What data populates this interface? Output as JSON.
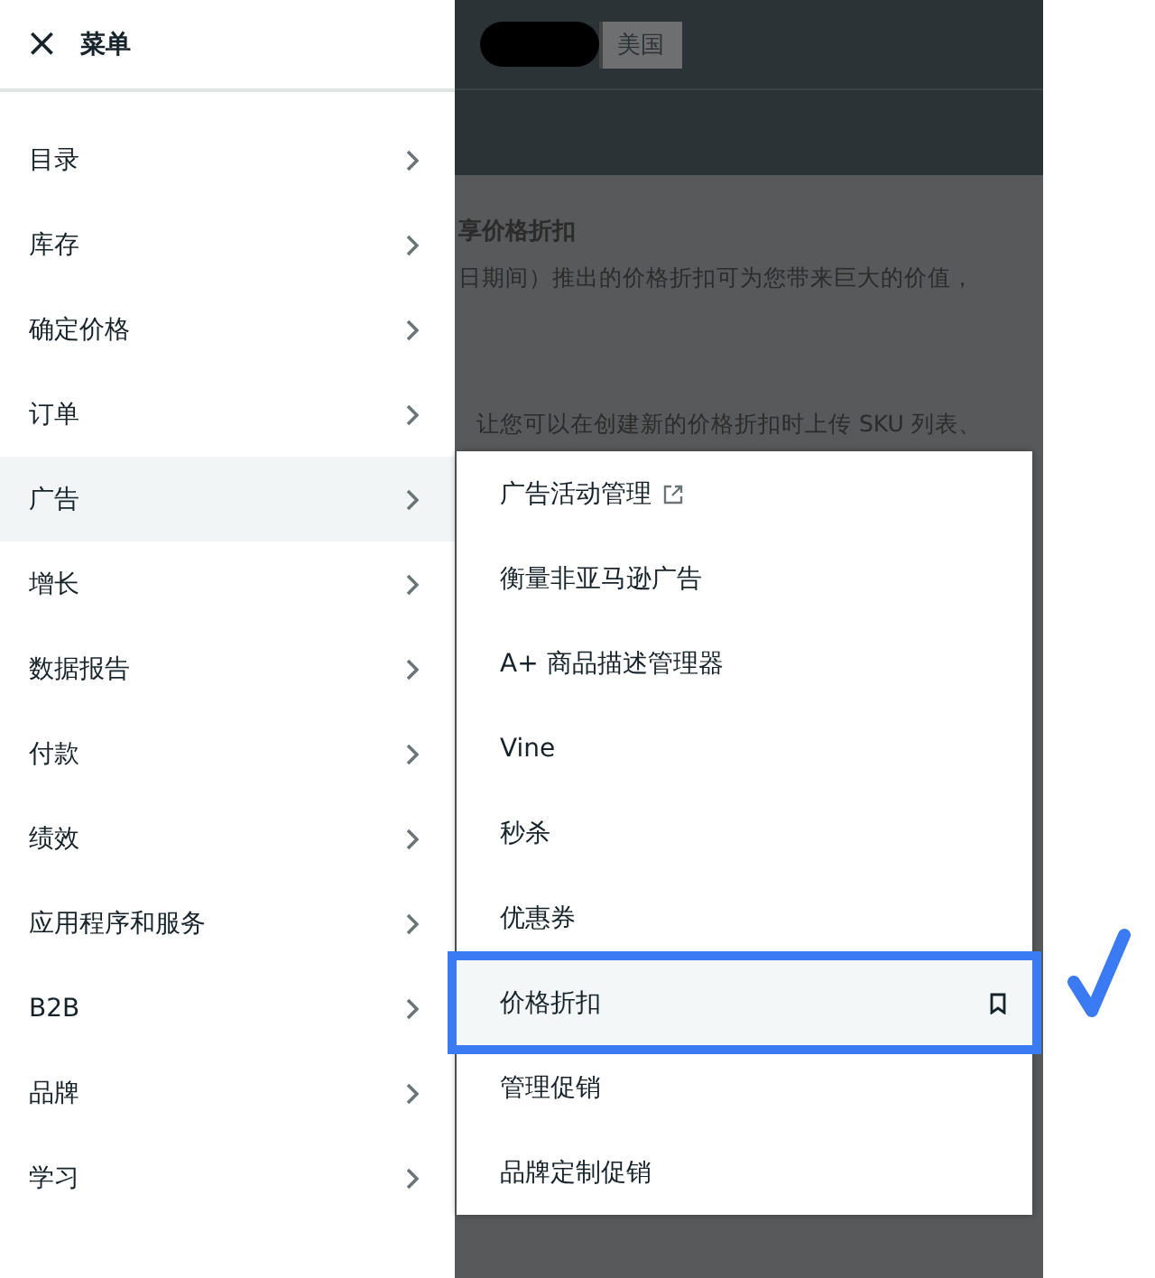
{
  "menu": {
    "close": "×",
    "title": "菜单",
    "items": [
      {
        "label": "目录",
        "selected": false
      },
      {
        "label": "库存",
        "selected": false
      },
      {
        "label": "确定价格",
        "selected": false
      },
      {
        "label": "订单",
        "selected": false
      },
      {
        "label": "广告",
        "selected": true
      },
      {
        "label": "增长",
        "selected": false
      },
      {
        "label": "数据报告",
        "selected": false
      },
      {
        "label": "付款",
        "selected": false
      },
      {
        "label": "绩效",
        "selected": false
      },
      {
        "label": "应用程序和服务",
        "selected": false
      },
      {
        "label": "B2B",
        "selected": false
      },
      {
        "label": "品牌",
        "selected": false
      },
      {
        "label": "学习",
        "selected": false
      }
    ]
  },
  "top_bar": {
    "region": "美国"
  },
  "background": {
    "heading": "享价格折扣",
    "line_1": "日期间）推出的价格折扣可为您带来巨大的价值，",
    "line_2": "让您可以在创建新的价格折扣时上传 SKU 列表、"
  },
  "submenu": {
    "items": [
      {
        "label": "广告活动管理",
        "kind": "external",
        "selected": false
      },
      {
        "label": "衡量非亚马逊广告",
        "kind": "plain",
        "selected": false
      },
      {
        "label": "A+ 商品描述管理器",
        "kind": "plain",
        "selected": false
      },
      {
        "label": "Vine",
        "kind": "plain",
        "selected": false
      },
      {
        "label": "秒杀",
        "kind": "plain",
        "selected": false
      },
      {
        "label": "优惠券",
        "kind": "plain",
        "selected": false
      },
      {
        "label": "价格折扣",
        "kind": "bookmark",
        "selected": true
      },
      {
        "label": "管理促销",
        "kind": "plain",
        "selected": false
      },
      {
        "label": "品牌定制促销",
        "kind": "plain",
        "selected": false
      }
    ]
  }
}
